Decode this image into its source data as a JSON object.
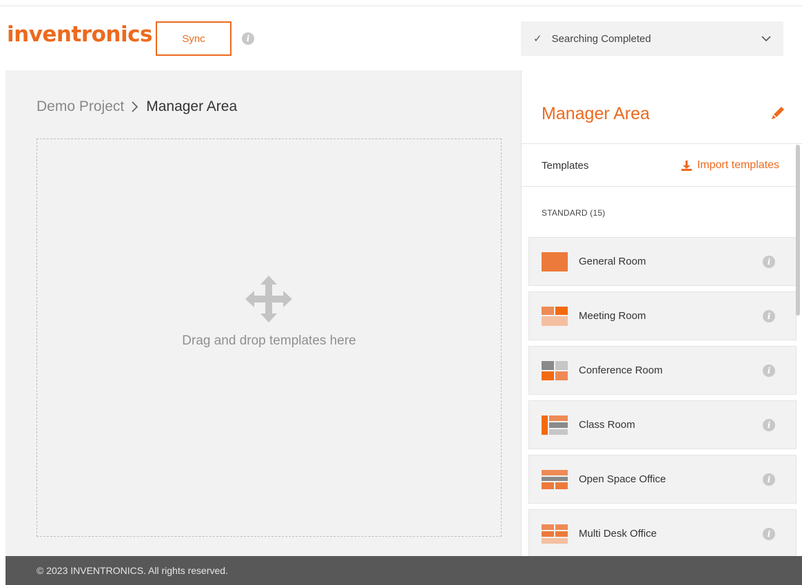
{
  "header": {
    "logo_text": "inventronics",
    "sync_label": "Sync",
    "status_text": "Searching Completed",
    "brand_color": "#ec6a1e"
  },
  "breadcrumb": {
    "project": "Demo Project",
    "current": "Manager Area"
  },
  "dropzone": {
    "text": "Drag and drop templates here",
    "icon": "move-icon"
  },
  "panel": {
    "title": "Manager Area",
    "templates_label": "Templates",
    "import_label": "Import templates",
    "standard_label": "STANDARD (15)",
    "items": [
      {
        "label": "General Room",
        "icon": "general-room-icon"
      },
      {
        "label": "Meeting Room",
        "icon": "meeting-room-icon"
      },
      {
        "label": "Conference Room",
        "icon": "conference-room-icon"
      },
      {
        "label": "Class Room",
        "icon": "class-room-icon"
      },
      {
        "label": "Open Space Office",
        "icon": "open-space-office-icon"
      },
      {
        "label": "Multi Desk Office",
        "icon": "multi-desk-office-icon"
      }
    ]
  },
  "footer": {
    "copyright": "© 2023 INVENTRONICS. All rights reserved."
  }
}
